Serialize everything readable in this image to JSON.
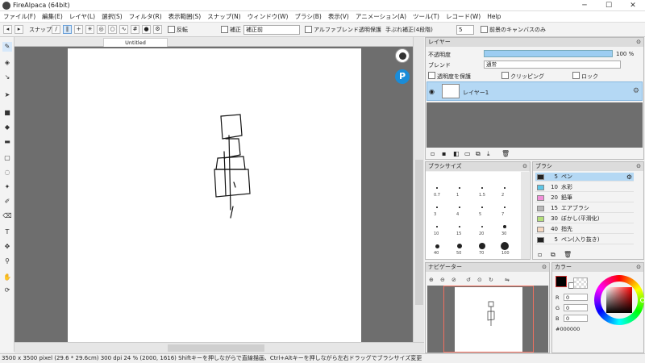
{
  "app": {
    "title": "FireAlpaca (64bit)"
  },
  "window": {
    "minimize": "─",
    "maximize": "☐",
    "close": "✕"
  },
  "menu": [
    "ファイル(F)",
    "編集(E)",
    "レイヤ(L)",
    "選択(S)",
    "フィルタ(R)",
    "表示範囲(S)",
    "スナップ(N)",
    "ウィンドウ(W)",
    "ブラシ(B)",
    "表示(V)",
    "アニメーション(A)",
    "ツール(T)",
    "レコード(W)",
    "Help"
  ],
  "toolbar": {
    "snap_label": "スナップ",
    "reverse_label": "反転",
    "antialias_label": "補正",
    "correction_value": "補正前",
    "protect_label": "アルファブレンド透明保護",
    "stabilizer_label": "手ぶれ補正(4段階)",
    "stabilizer_value": "5",
    "canvas_only_label": "前景のキャンバスのみ"
  },
  "document": {
    "tab_title": "Untitled"
  },
  "layer_panel": {
    "title": "レイヤー",
    "opacity_label": "不透明度",
    "opacity_value": "100 %",
    "blend_label": "ブレンド",
    "blend_value": "通常",
    "protect_alpha": "透明度を保護",
    "clipping": "クリッピング",
    "lock": "ロック",
    "layers": [
      {
        "name": "レイヤー1"
      }
    ]
  },
  "brush_panel": {
    "title": "ブラシサイズ",
    "sizes": [
      "0.7",
      "1",
      "1.5",
      "2",
      "3",
      "4",
      "5",
      "7",
      "10",
      "15",
      "20",
      "30",
      "40",
      "50",
      "70",
      "100"
    ]
  },
  "colorset_panel": {
    "title": "ブラシ",
    "items": [
      {
        "num": "5",
        "name": "ペン",
        "color": "#222222"
      },
      {
        "num": "10",
        "name": "水彩",
        "color": "#5ec6e6"
      },
      {
        "num": "20",
        "name": "鉛筆",
        "color": "#f08fd8"
      },
      {
        "num": "15",
        "name": "エアブラシ",
        "color": "#b8b8b8"
      },
      {
        "num": "30",
        "name": "ぼかし(平滑化)",
        "color": "#b4e07a"
      },
      {
        "num": "40",
        "name": "指先",
        "color": "#f6d8c0"
      },
      {
        "num": "5",
        "name": "ペン(入り抜き)",
        "color": "#222222"
      }
    ]
  },
  "navigator_panel": {
    "title": "ナビゲーター"
  },
  "color_panel": {
    "title": "カラー",
    "r_label": "R",
    "r_value": "0",
    "g_label": "G",
    "g_value": "0",
    "b_label": "B",
    "b_value": "0",
    "hex_value": "#000000",
    "primary_color": "#000000"
  },
  "status": {
    "text": "3500 x 3500 pixel   (29.6 * 29.6cm)   300 dpi   24 %   (2000, 1616)   Shiftキーを押しながらで直線描画、Ctrl+Altキーを押しながら左右ドラッグでブラシサイズ変更"
  }
}
